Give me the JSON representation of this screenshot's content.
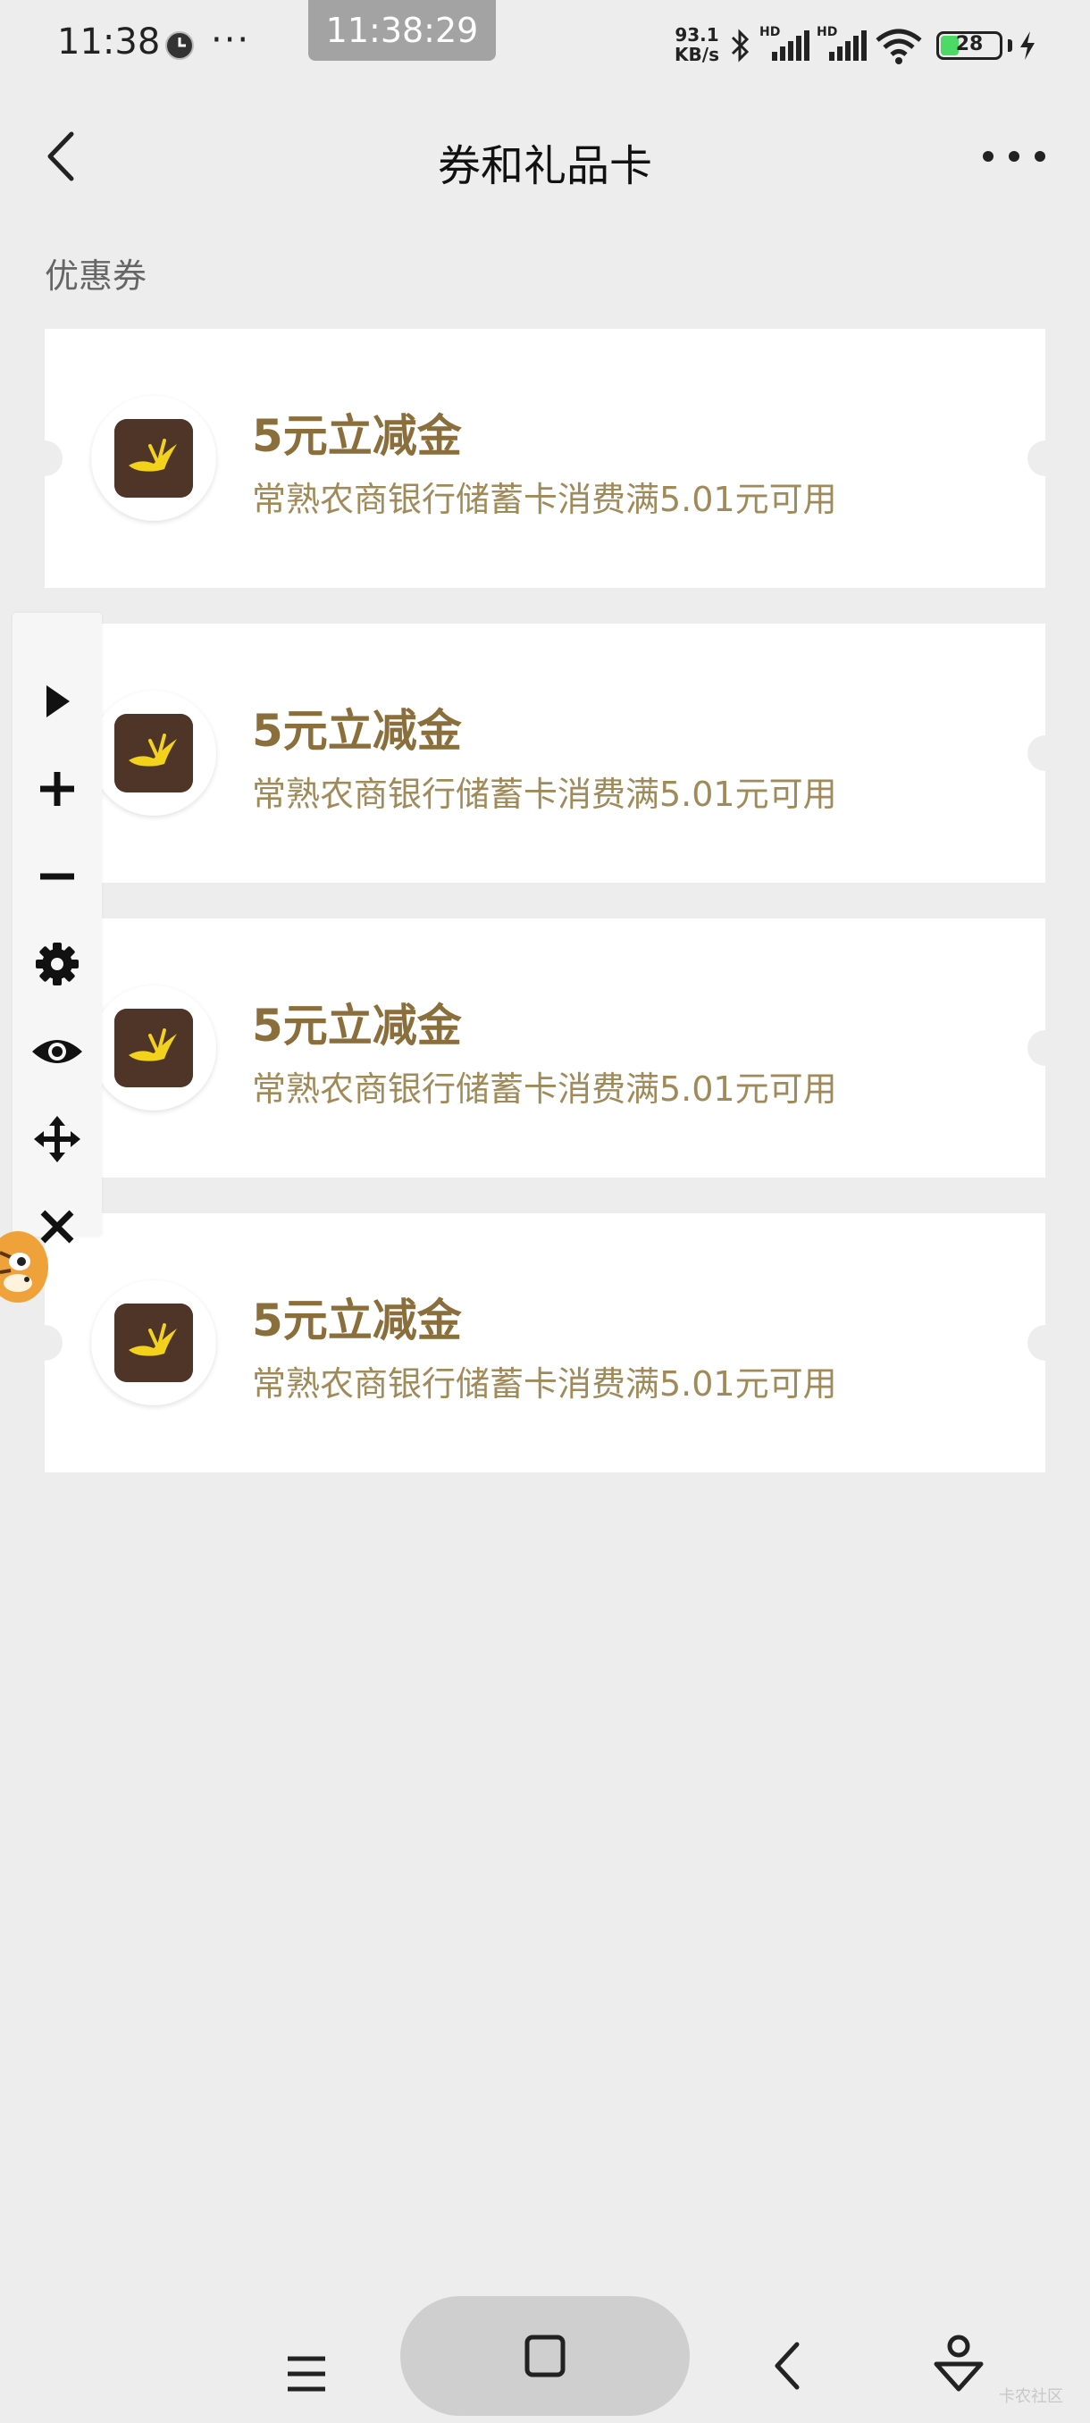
{
  "status_bar": {
    "time": "11:38",
    "more": "···",
    "overlay_clock": "11:38:29",
    "net_speed_value": "93.1",
    "net_speed_unit": "KB/s",
    "hd_label": "HD",
    "battery": "28"
  },
  "header": {
    "title": "券和礼品卡"
  },
  "section": {
    "label": "优惠券"
  },
  "coupons": [
    {
      "title": "5元立减金",
      "desc": "常熟农商银行储蓄卡消费满5.01元可用"
    },
    {
      "title": "5元立减金",
      "desc": "常熟农商银行储蓄卡消费满5.01元可用"
    },
    {
      "title": "5元立减金",
      "desc": "常熟农商银行储蓄卡消费满5.01元可用"
    },
    {
      "title": "5元立减金",
      "desc": "常熟农商银行储蓄卡消费满5.01元可用"
    }
  ],
  "float_toolbar": {
    "icons": [
      "play-icon",
      "plus-icon",
      "minus-icon",
      "gear-icon",
      "eye-icon",
      "move-icon",
      "close-icon"
    ]
  },
  "colors": {
    "background": "#ededed",
    "coupon_title": "#8a6e3c",
    "coupon_desc": "#a08a5a",
    "logo_bg": "#4f3527",
    "logo_mark": "#f2d21a"
  },
  "watermark": "卡农社区"
}
